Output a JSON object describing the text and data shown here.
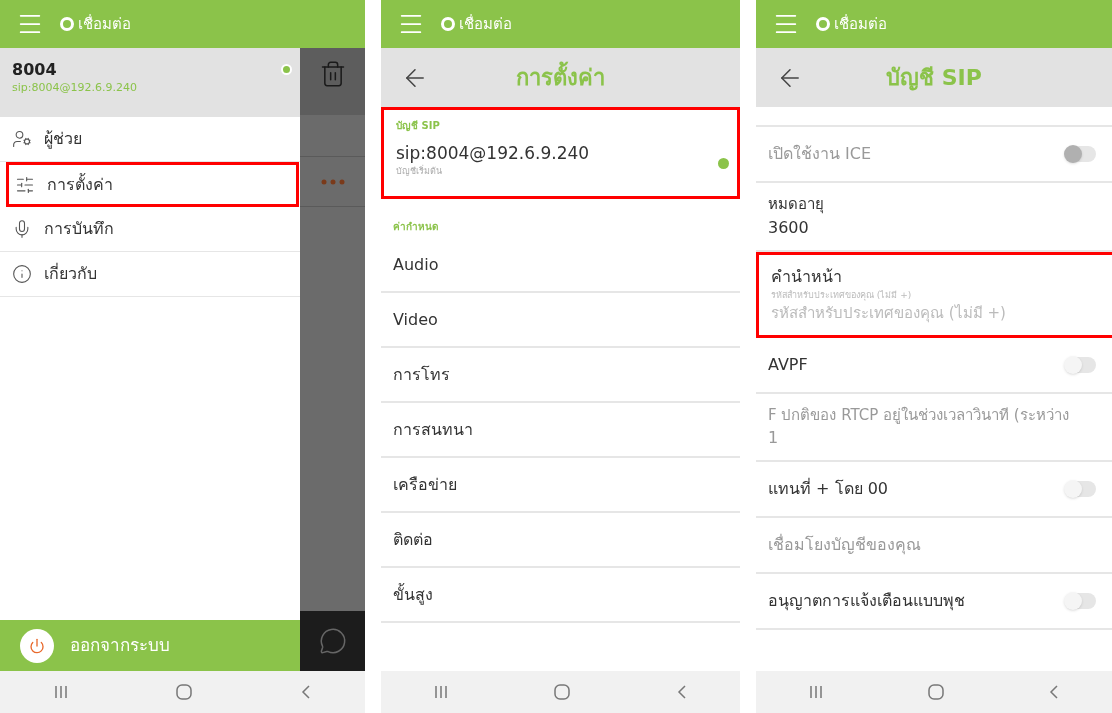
{
  "drawer_screen": {
    "status_bar": {
      "label": "เชื่อมต่อ"
    },
    "account": {
      "name": "8004",
      "address": "sip:8004@192.6.9.240",
      "online": true
    },
    "menu": [
      {
        "kind": "assistant",
        "label": "ผู้ช่วย",
        "highlighted": false
      },
      {
        "kind": "settings",
        "label": "การตั้งค่า",
        "highlighted": true
      },
      {
        "kind": "recordings",
        "label": "การบันทึก",
        "highlighted": false
      },
      {
        "kind": "about",
        "label": "เกี่ยวกับ",
        "highlighted": false
      }
    ],
    "logout": {
      "label": "ออกจากระบบ"
    }
  },
  "settings_screen": {
    "status_bar": {
      "label": "เชื่อมต่อ"
    },
    "title": "การตั้งค่า",
    "account_section": {
      "label": "บัญชี SIP",
      "address": "sip:8004@192.6.9.240",
      "subtitle": "บัญชีเริ่มต้น",
      "online": true,
      "highlighted": true
    },
    "preferences": {
      "label": "ค่ากำหนด",
      "items": [
        "Audio",
        "Video",
        "การโทร",
        "การสนทนา",
        "เครือข่าย",
        "ติดต่อ",
        "ขั้นสูง"
      ]
    }
  },
  "sip_account_screen": {
    "status_bar": {
      "label": "เชื่อมต่อ"
    },
    "title": "บัญชี SIP",
    "rows": [
      {
        "kind": "switch",
        "label": "เปิดใช้งาน ICE",
        "on": false,
        "disabled": true,
        "highlighted": false
      },
      {
        "kind": "value",
        "label": "หมดอายุ",
        "value": "3600",
        "disabled": false,
        "highlighted": false
      },
      {
        "kind": "input",
        "label": "คำนำหน้า",
        "hint": "รหัสสำหรับประเทศของคุณ (ไม่มี +)",
        "placeholder": "รหัสสำหรับประเทศของคุณ (ไม่มี +)",
        "disabled": false,
        "highlighted": true
      },
      {
        "kind": "switch",
        "label": "AVPF",
        "on": false,
        "disabled": false,
        "highlighted": false
      },
      {
        "kind": "value",
        "label": "F ปกติของ RTCP อยู่ในช่วงเวลาวินาที (ระหว่าง",
        "value": "1",
        "disabled": true,
        "highlighted": false
      },
      {
        "kind": "switch",
        "label": "แทนที่ + โดย 00",
        "on": false,
        "disabled": false,
        "highlighted": false
      },
      {
        "kind": "link",
        "label": "เชื่อมโยงบัญชีของคุณ",
        "disabled": true,
        "highlighted": false
      },
      {
        "kind": "switch",
        "label": "อนุญาตการแจ้งเตือนแบบพุช",
        "on": false,
        "disabled": false,
        "highlighted": false
      }
    ]
  }
}
